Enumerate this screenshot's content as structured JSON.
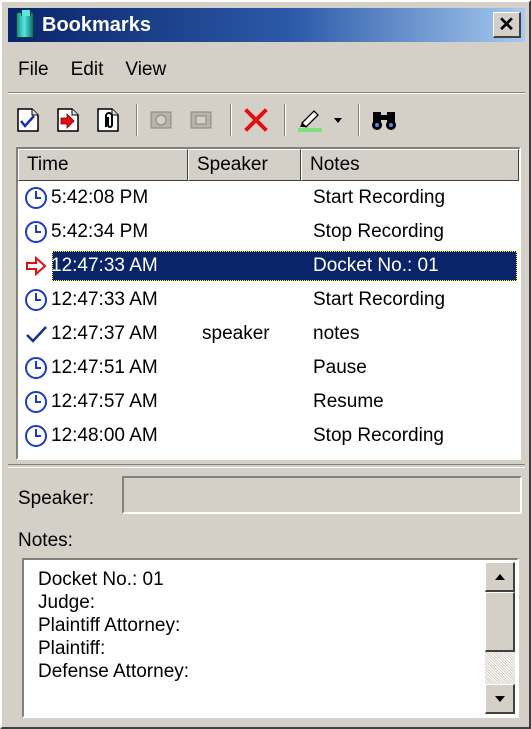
{
  "window": {
    "title": "Bookmarks",
    "close_label": "✕"
  },
  "menu": {
    "items": [
      "File",
      "Edit",
      "View"
    ]
  },
  "columns": {
    "time": "Time",
    "speaker": "Speaker",
    "notes": "Notes"
  },
  "rows": [
    {
      "icon": "clock-icon",
      "time": "5:42:08 PM",
      "speaker": "",
      "notes": "Start Recording",
      "selected": false
    },
    {
      "icon": "clock-icon",
      "time": "5:42:34 PM",
      "speaker": "",
      "notes": "Stop Recording",
      "selected": false
    },
    {
      "icon": "arrow-right-icon",
      "time": "12:47:33 AM",
      "speaker": "",
      "notes": "Docket No.: 01",
      "selected": true
    },
    {
      "icon": "clock-icon",
      "time": "12:47:33 AM",
      "speaker": "",
      "notes": "Start Recording",
      "selected": false
    },
    {
      "icon": "checkmark-icon",
      "time": "12:47:37 AM",
      "speaker": "speaker",
      "notes": "notes",
      "selected": false
    },
    {
      "icon": "clock-icon",
      "time": "12:47:51 AM",
      "speaker": "",
      "notes": "Pause",
      "selected": false
    },
    {
      "icon": "clock-icon",
      "time": "12:47:57 AM",
      "speaker": "",
      "notes": "Resume",
      "selected": false
    },
    {
      "icon": "clock-icon",
      "time": "12:48:00 AM",
      "speaker": "",
      "notes": "Stop Recording",
      "selected": false
    }
  ],
  "detail": {
    "speaker_label": "Speaker:",
    "speaker_value": "",
    "notes_label": "Notes:",
    "notes_lines": [
      "Docket No.: 01",
      "Judge:",
      "Plaintiff Attorney:",
      "Plaintiff:",
      "Defense Attorney:"
    ]
  },
  "colors": {
    "selection": "#0a246a",
    "clock": "#1a3ac8",
    "arrow": "#e01010",
    "title_gradient_start": "#0a246a"
  }
}
